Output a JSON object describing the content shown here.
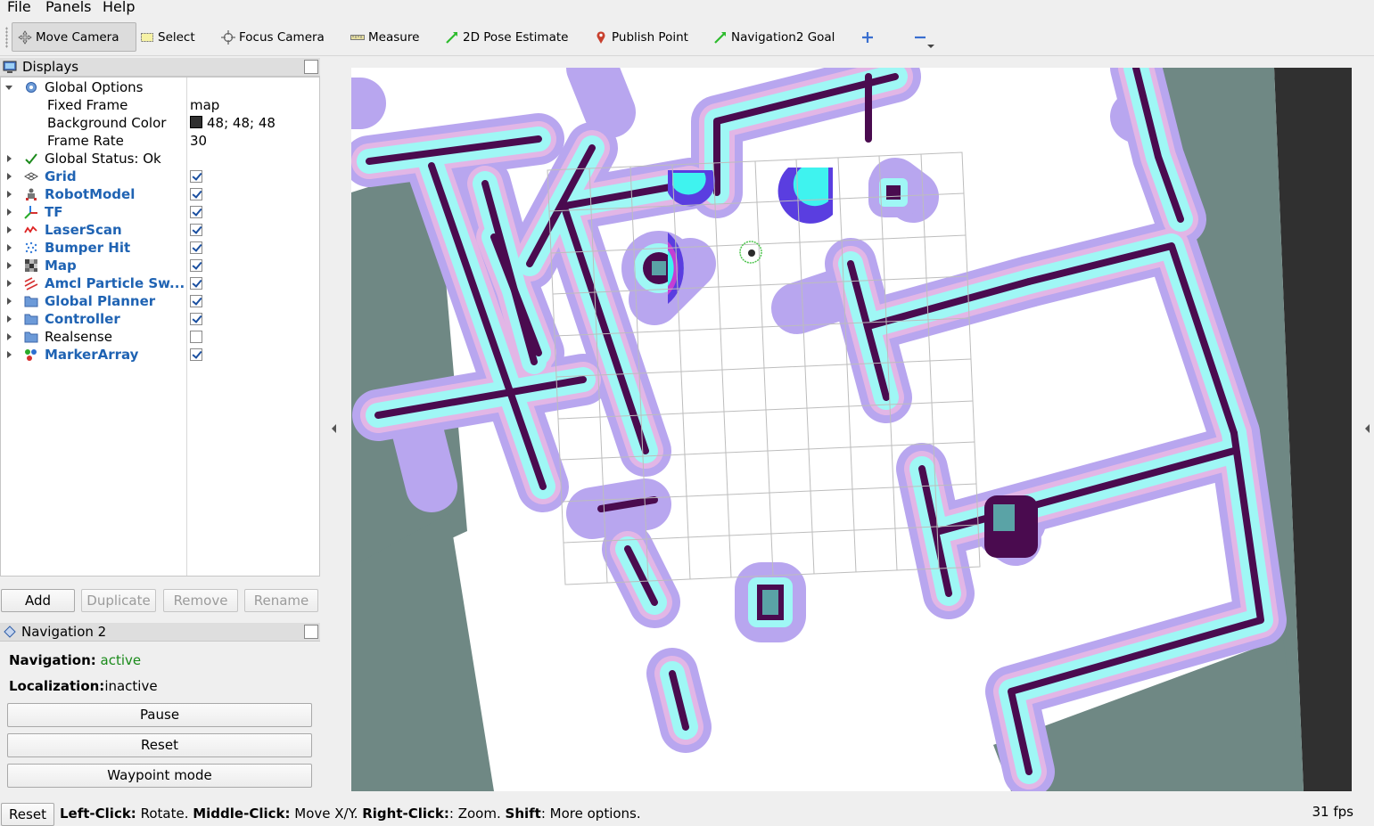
{
  "menu": [
    "File",
    "Panels",
    "Help"
  ],
  "toolbar": {
    "tools": [
      {
        "label": "Move Camera",
        "icon": "move-camera-icon"
      },
      {
        "label": "Select",
        "icon": "select-icon"
      },
      {
        "label": "Focus Camera",
        "icon": "focus-camera-icon"
      },
      {
        "label": "Measure",
        "icon": "measure-icon"
      },
      {
        "label": "2D Pose Estimate",
        "icon": "pose-estimate-icon"
      },
      {
        "label": "Publish Point",
        "icon": "publish-point-icon"
      },
      {
        "label": "Navigation2 Goal",
        "icon": "nav-goal-icon"
      }
    ]
  },
  "displays": {
    "title": "Displays",
    "global_options": {
      "label": "Global Options",
      "props": [
        {
          "name": "Fixed Frame",
          "value": "map"
        },
        {
          "name": "Background Color",
          "value": "48; 48; 48"
        },
        {
          "name": "Frame Rate",
          "value": "30"
        }
      ]
    },
    "global_status": "Global Status: Ok",
    "items": [
      {
        "label": "Grid",
        "checked": true
      },
      {
        "label": "RobotModel",
        "checked": true
      },
      {
        "label": "TF",
        "checked": true
      },
      {
        "label": "LaserScan",
        "checked": true
      },
      {
        "label": "Bumper Hit",
        "checked": true
      },
      {
        "label": "Map",
        "checked": true
      },
      {
        "label": "Amcl Particle Sw...",
        "checked": true
      },
      {
        "label": "Global Planner",
        "checked": true
      },
      {
        "label": "Controller",
        "checked": true
      },
      {
        "label": "Realsense",
        "checked": false
      },
      {
        "label": "MarkerArray",
        "checked": true
      }
    ],
    "buttons": {
      "add": "Add",
      "duplicate": "Duplicate",
      "remove": "Remove",
      "rename": "Rename"
    }
  },
  "navigation": {
    "title": "Navigation 2",
    "nav_label": "Navigation:",
    "nav_value": "active",
    "loc_label": "Localization:",
    "loc_value": "inactive",
    "pause": "Pause",
    "reset": "Reset",
    "waypoint": "Waypoint mode"
  },
  "status": {
    "reset": "Reset",
    "left_click": "Left-Click:",
    "left_desc": " Rotate. ",
    "middle_click": "Middle-Click:",
    "middle_desc": " Move X/Y. ",
    "right_click": "Right-Click:",
    "right_desc": ": Zoom. ",
    "shift": "Shift",
    "shift_desc": ": More options.",
    "fps": "31 fps"
  },
  "colors": {
    "background": "#303030",
    "free_space": "#ffffff",
    "unknown": "#6f8884",
    "obstacle": "#4a0b4f",
    "inflation_cyan": "#9ff7f5",
    "inflation_pink": "#e2b6e6",
    "inflation_lavender": "#b8a6ef",
    "teal_border": "#5aa3a6",
    "accent": "#1f63b3",
    "status_active": "#1a8a1a"
  }
}
